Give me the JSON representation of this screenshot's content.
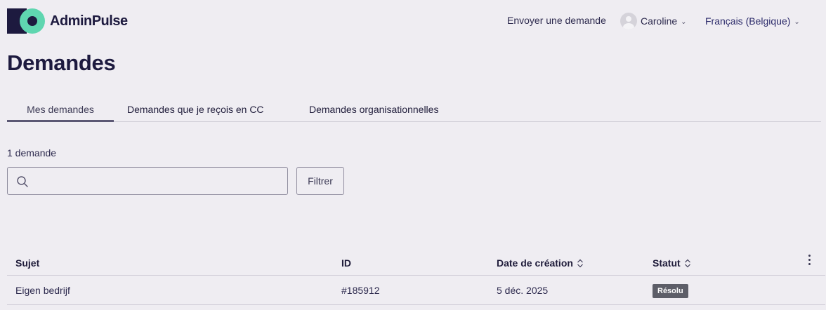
{
  "header": {
    "logo_text": "AdminPulse",
    "send_request": "Envoyer une demande",
    "user_name": "Caroline",
    "language": "Français (Belgique)"
  },
  "page": {
    "title": "Demandes"
  },
  "tabs": [
    {
      "label": "Mes demandes",
      "active": true
    },
    {
      "label": "Demandes que je reçois en CC",
      "active": false
    },
    {
      "label": "Demandes organisationnelles",
      "active": false
    }
  ],
  "results": {
    "count_text": "1 demande"
  },
  "search": {
    "value": "",
    "placeholder": ""
  },
  "filter": {
    "label": "Filtrer"
  },
  "table": {
    "columns": {
      "subject": "Sujet",
      "id": "ID",
      "created": "Date de création",
      "status": "Statut"
    },
    "rows": [
      {
        "subject": "Eigen bedrijf",
        "id": "#185912",
        "created": "5 déc. 2025",
        "status": "Résolu"
      }
    ]
  },
  "colors": {
    "background": "#efedf2",
    "brand_dark": "#1d1a3f",
    "brand_accent": "#5fd6b0",
    "status_badge": "#5d5e68"
  },
  "icons": [
    "search-icon",
    "chevron-down-icon",
    "sort-icon",
    "kebab-menu-icon",
    "avatar-icon"
  ]
}
